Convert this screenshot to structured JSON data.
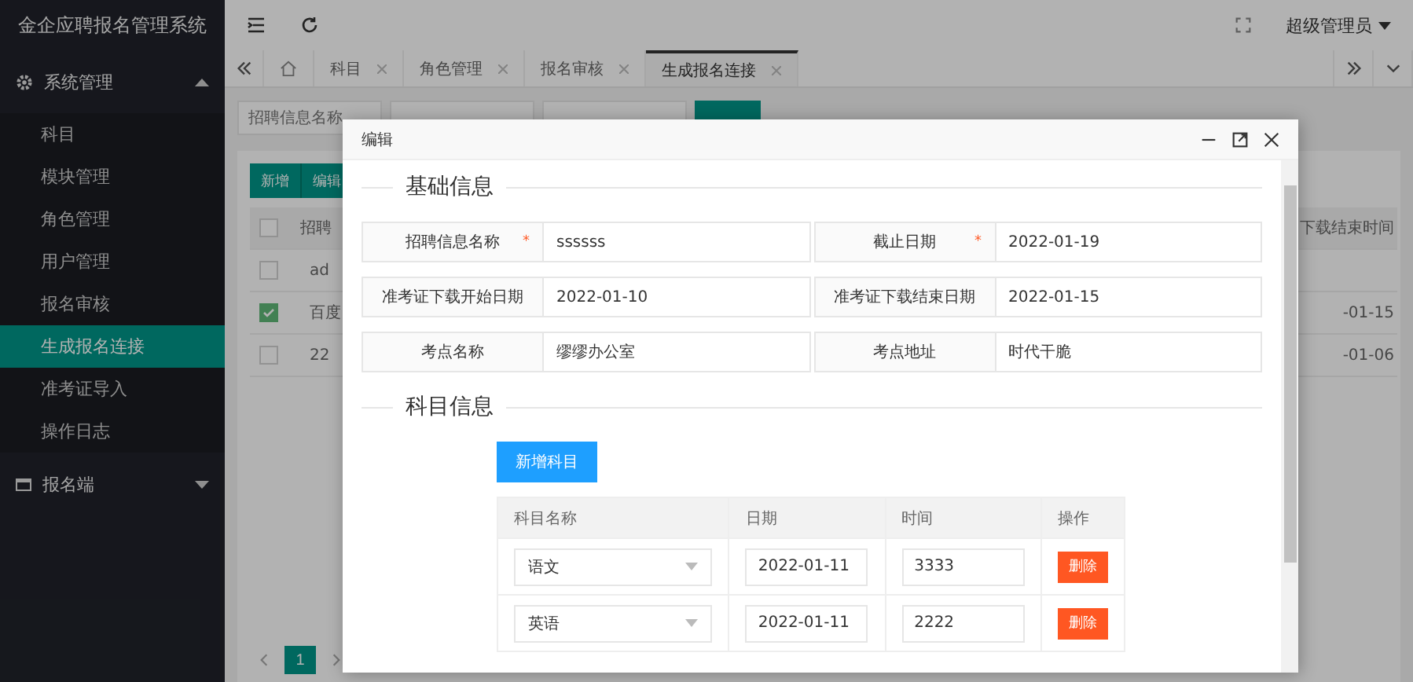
{
  "app_title": "金企应聘报名管理系统",
  "sidebar": {
    "groups": [
      {
        "label": "系统管理",
        "kind": "gear",
        "expanded": true,
        "children": [
          {
            "label": "科目",
            "selected": false
          },
          {
            "label": "模块管理",
            "selected": false
          },
          {
            "label": "角色管理",
            "selected": false
          },
          {
            "label": "用户管理",
            "selected": false
          },
          {
            "label": "报名审核",
            "selected": false
          },
          {
            "label": "生成报名连接",
            "selected": true
          },
          {
            "label": "准考证导入",
            "selected": false
          },
          {
            "label": "操作日志",
            "selected": false
          }
        ]
      },
      {
        "label": "报名端",
        "kind": "window",
        "expanded": false
      }
    ]
  },
  "header": {
    "user": "超级管理员"
  },
  "tabs": [
    {
      "kind": "home",
      "selected": false
    },
    {
      "kind": "page",
      "label": "科目",
      "selected": false
    },
    {
      "kind": "page",
      "label": "角色管理",
      "selected": false
    },
    {
      "kind": "page",
      "label": "报名审核",
      "selected": false
    },
    {
      "kind": "page",
      "label": "生成报名连接",
      "selected": true
    }
  ],
  "search": {
    "placeholder": "招聘信息名称"
  },
  "toolbar": [
    "新增",
    "编辑"
  ],
  "table": {
    "columns": [
      "招聘",
      "下载结束时间"
    ],
    "all_checked": false,
    "rows": [
      {
        "checked": false,
        "cells": [
          "ad",
          ""
        ]
      },
      {
        "checked": true,
        "cells": [
          "百度",
          "-01-15"
        ]
      },
      {
        "checked": false,
        "cells": [
          "22",
          "-01-06"
        ]
      }
    ]
  },
  "pagination": {
    "pages": [
      {
        "label": "1",
        "selected": true
      }
    ]
  },
  "dialog": {
    "title": "编辑",
    "basic_section": {
      "legend": "基础信息",
      "fields": [
        {
          "label": "招聘信息名称",
          "required_mark": "*",
          "value": "ssssss"
        },
        {
          "label": "截止日期",
          "required_mark": "*",
          "value": "2022-01-19"
        },
        {
          "label": "准考证下载开始日期",
          "value": "2022-01-10"
        },
        {
          "label": "准考证下载结束日期",
          "value": "2022-01-15"
        },
        {
          "label": "考点名称",
          "value": "缪缪办公室"
        },
        {
          "label": "考点地址",
          "value": "时代干脆"
        }
      ]
    },
    "subject_section": {
      "legend": "科目信息",
      "add_button": "新增科目",
      "columns": [
        "科目名称",
        "日期",
        "时间",
        "操作"
      ],
      "rows": [
        {
          "subject": "语文",
          "date": "2022-01-11",
          "time": "3333",
          "action": "删除"
        },
        {
          "subject": "英语",
          "date": "2022-01-11",
          "time": "2222",
          "action": "删除"
        }
      ]
    }
  }
}
